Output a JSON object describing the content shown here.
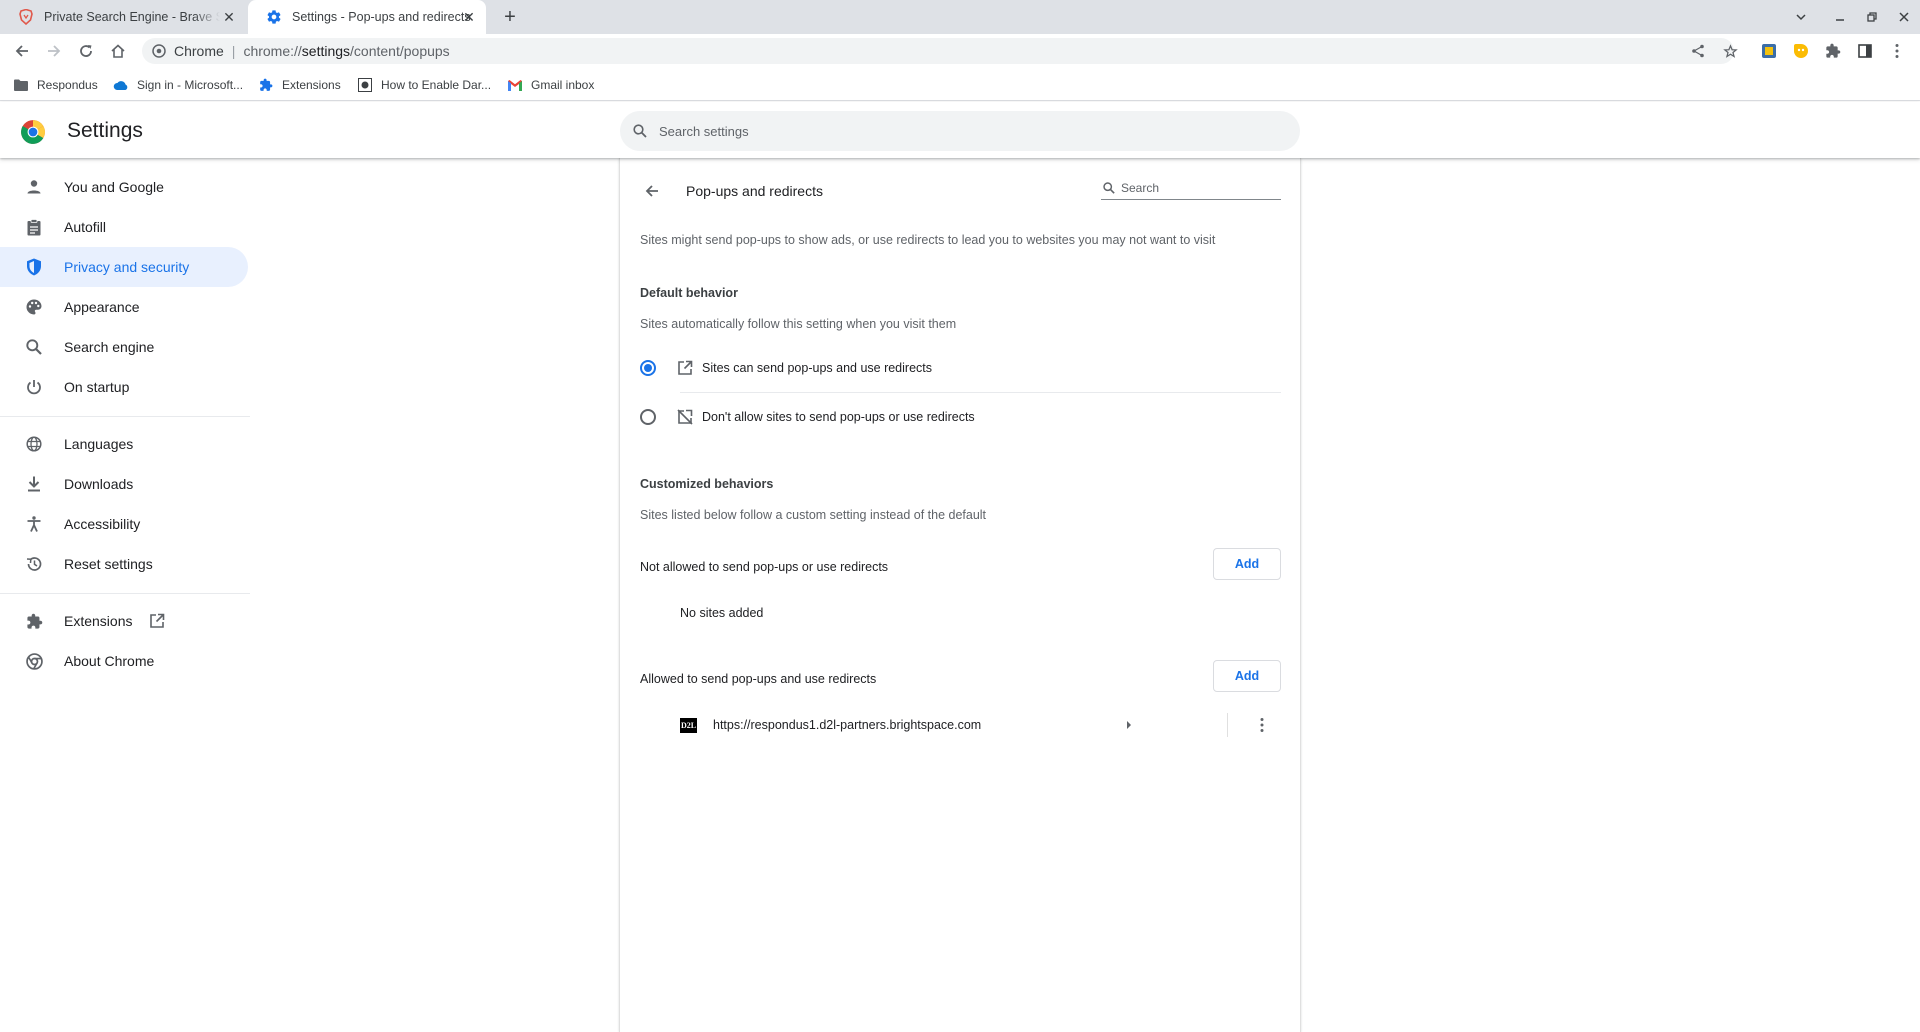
{
  "browser": {
    "tabs": [
      {
        "title": "Private Search Engine - Brave Search",
        "icon": "brave-lion-icon",
        "active": false
      },
      {
        "title": "Settings - Pop-ups and redirects",
        "icon": "gear-icon",
        "active": true
      }
    ],
    "omnibox": {
      "site_label": "Chrome",
      "url_prefix": "chrome://",
      "url_host": "settings",
      "url_path": "/content/popups"
    },
    "bookmarks": [
      {
        "label": "Respondus",
        "icon": "folder-icon"
      },
      {
        "label": "Sign in - Microsoft...",
        "icon": "onedrive-cloud-icon"
      },
      {
        "label": "Extensions",
        "icon": "puzzle-icon"
      },
      {
        "label": "How to Enable Dar...",
        "icon": "site-favicon-icon"
      },
      {
        "label": "Gmail inbox",
        "icon": "gmail-icon"
      }
    ]
  },
  "settings": {
    "title": "Settings",
    "search_placeholder": "Search settings",
    "nav": [
      {
        "label": "You and Google",
        "icon": "person-icon"
      },
      {
        "label": "Autofill",
        "icon": "clipboard-icon"
      },
      {
        "label": "Privacy and security",
        "icon": "shield-icon",
        "active": true
      },
      {
        "label": "Appearance",
        "icon": "palette-icon"
      },
      {
        "label": "Search engine",
        "icon": "search-icon"
      },
      {
        "label": "On startup",
        "icon": "power-icon"
      },
      {
        "label": "Languages",
        "icon": "globe-icon"
      },
      {
        "label": "Downloads",
        "icon": "download-icon"
      },
      {
        "label": "Accessibility",
        "icon": "accessibility-icon"
      },
      {
        "label": "Reset settings",
        "icon": "history-icon"
      },
      {
        "label": "Extensions",
        "icon": "puzzle-icon"
      },
      {
        "label": "About Chrome",
        "icon": "chrome-icon"
      }
    ]
  },
  "page": {
    "title": "Pop-ups and redirects",
    "search_placeholder": "Search",
    "description": "Sites might send pop-ups to show ads, or use redirects to lead you to websites you may not want to visit",
    "default_behavior": {
      "heading": "Default behavior",
      "subtext": "Sites automatically follow this setting when you visit them",
      "options": [
        {
          "label": "Sites can send pop-ups and use redirects",
          "icon": "open-in-new-icon",
          "selected": true
        },
        {
          "label": "Don't allow sites to send pop-ups or use redirects",
          "icon": "popup-blocked-icon",
          "selected": false
        }
      ]
    },
    "customized": {
      "heading": "Customized behaviors",
      "subtext": "Sites listed below follow a custom setting instead of the default",
      "blocked": {
        "label": "Not allowed to send pop-ups or use redirects",
        "button": "Add",
        "empty": "No sites added"
      },
      "allowed": {
        "label": "Allowed to send pop-ups and use redirects",
        "button": "Add",
        "sites": [
          {
            "url": "https://respondus1.d2l-partners.brightspace.com",
            "favicon": "D2L"
          }
        ]
      }
    }
  },
  "colors": {
    "accent": "#1a73e8",
    "active_nav_bg": "#e8f0fe",
    "tabstrip": "#dee1e6"
  }
}
